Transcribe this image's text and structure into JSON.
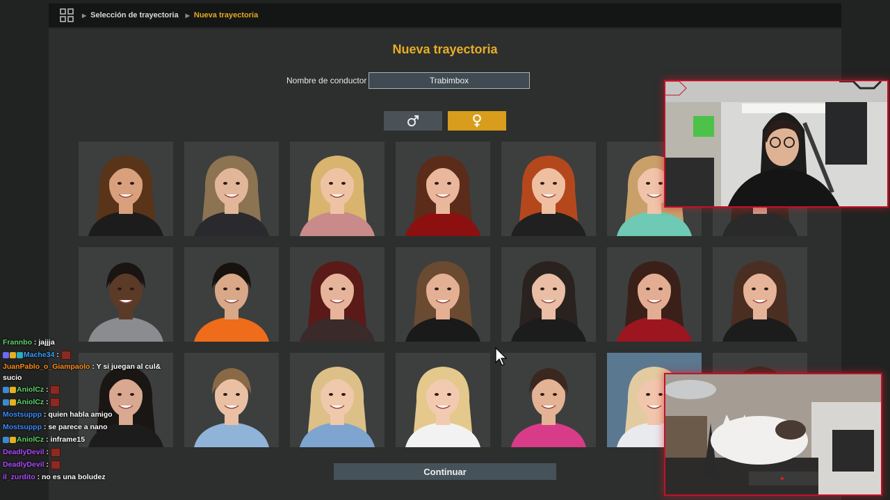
{
  "breadcrumb": {
    "items": [
      "Selección de trayectoria",
      "Nueva trayectoria"
    ]
  },
  "page": {
    "title": "Nueva trayectoria",
    "driver_name_label": "Nombre de conductor",
    "driver_name_value": "Trabimbox",
    "gender_male_icon": "male-symbol-icon",
    "gender_female_icon": "female-symbol-icon",
    "selected_gender": "female",
    "continue_label": "Continuar"
  },
  "portraits": [
    {
      "hair": "#5a3418",
      "skin": "#d9a07e",
      "shirt": "#1c1c1c",
      "bg": "#3c3f3e",
      "long": true
    },
    {
      "hair": "#8c7352",
      "skin": "#e2b699",
      "shirt": "#2a2a2e",
      "bg": "#3c3f3e",
      "long": true
    },
    {
      "hair": "#d8b46e",
      "skin": "#eec3a4",
      "shirt": "#c98a8a",
      "bg": "#3c3f3e",
      "long": true
    },
    {
      "hair": "#5b2c1a",
      "skin": "#eab79c",
      "shirt": "#8c1010",
      "bg": "#3c3f3e",
      "long": true
    },
    {
      "hair": "#b4481c",
      "skin": "#efbfa2",
      "shirt": "#202020",
      "bg": "#3c3f3e",
      "long": true
    },
    {
      "hair": "#c9a06a",
      "skin": "#efc4a8",
      "shirt": "#6ec9b5",
      "bg": "#3c3f3e",
      "long": true
    },
    {
      "hair": "#3a2a22",
      "skin": "#caa08a",
      "shirt": "#2a2a2a",
      "bg": "#3c3f3e",
      "long": true
    },
    {
      "hair": "#1a1412",
      "skin": "#5b3a28",
      "shirt": "#8a8c90",
      "bg": "#3c3f3e",
      "long": false
    },
    {
      "hair": "#18120e",
      "skin": "#d8a888",
      "shirt": "#ee6c1a",
      "bg": "#3c3f3e",
      "long": false
    },
    {
      "hair": "#5a1a18",
      "skin": "#e6b49a",
      "shirt": "#3a2a2a",
      "bg": "#3c3f3e",
      "long": true
    },
    {
      "hair": "#6a4a30",
      "skin": "#e4b094",
      "shirt": "#1a1a1a",
      "bg": "#3c3f3e",
      "long": true
    },
    {
      "hair": "#2a221e",
      "skin": "#e9bea4",
      "shirt": "#1c1c1c",
      "bg": "#3c3f3e",
      "long": true
    },
    {
      "hair": "#3a2018",
      "skin": "#e2ad92",
      "shirt": "#9c1620",
      "bg": "#3c3f3e",
      "long": true
    },
    {
      "hair": "#4a2e22",
      "skin": "#e6b498",
      "shirt": "#1c1c1c",
      "bg": "#3c3f3e",
      "long": true
    },
    {
      "hair": "#1a1614",
      "skin": "#d9a890",
      "shirt": "#1c1c1c",
      "bg": "#3c3f3e",
      "long": true
    },
    {
      "hair": "#8a6a46",
      "skin": "#eac0a4",
      "shirt": "#8fb4d8",
      "bg": "#3c3f3e",
      "long": false
    },
    {
      "hair": "#dcc088",
      "skin": "#f0c8ac",
      "shirt": "#7ea4d0",
      "bg": "#3c3f3e",
      "long": true
    },
    {
      "hair": "#e4c88c",
      "skin": "#f2cab0",
      "shirt": "#f2f2f2",
      "bg": "#3c3f3e",
      "long": true
    },
    {
      "hair": "#3a2820",
      "skin": "#e4b294",
      "shirt": "#d83c88",
      "bg": "#3c3f3e",
      "long": false
    },
    {
      "hair": "#e2cba0",
      "skin": "#f0c6ac",
      "shirt": "#e8eaee",
      "bg": "#5a7890",
      "long": true
    },
    {
      "hair": "#3a2820",
      "skin": "#e0ae94",
      "shirt": "#2a2a2a",
      "bg": "#3c3f3e",
      "long": true
    }
  ],
  "chat": [
    {
      "user": "Frannbo",
      "color": "#5fd36a",
      "msg": "jajjja",
      "badges": [],
      "emote": false
    },
    {
      "user": "Mache34",
      "color": "#3aa0ff",
      "msg": "",
      "badges": [
        "#6a6aff",
        "#e6b020",
        "#2ab0c0"
      ],
      "emote": true
    },
    {
      "user": "JuanPablo_o_Giampaolo",
      "color": "#ff8c1a",
      "msg": "Y si juegan al cul& sucio",
      "badges": [],
      "emote": false
    },
    {
      "user": "AniolCz",
      "color": "#5fd36a",
      "msg": "",
      "badges": [
        "#3a8ad8",
        "#e6b020"
      ],
      "emote": true
    },
    {
      "user": "AniolCz",
      "color": "#5fd36a",
      "msg": "",
      "badges": [
        "#3a8ad8",
        "#e6b020"
      ],
      "emote": true
    },
    {
      "user": "Mostsuppp",
      "color": "#3a8aff",
      "msg": "quien habla amigo",
      "badges": [],
      "emote": false
    },
    {
      "user": "Mostsuppp",
      "color": "#3a8aff",
      "msg": "se parece a nano",
      "badges": [],
      "emote": false
    },
    {
      "user": "AniolCz",
      "color": "#5fd36a",
      "msg": "inframe15",
      "badges": [
        "#3a8ad8",
        "#e6b020"
      ],
      "emote": false
    },
    {
      "user": "DeadlyDevil",
      "color": "#b04aff",
      "msg": "",
      "badges": [],
      "emote": true
    },
    {
      "user": "DeadlyDevil",
      "color": "#b04aff",
      "msg": "",
      "badges": [],
      "emote": true
    },
    {
      "user": "il_zurdito",
      "color": "#b04aff",
      "msg": "no es una boludez",
      "badges": [],
      "emote": false
    }
  ]
}
